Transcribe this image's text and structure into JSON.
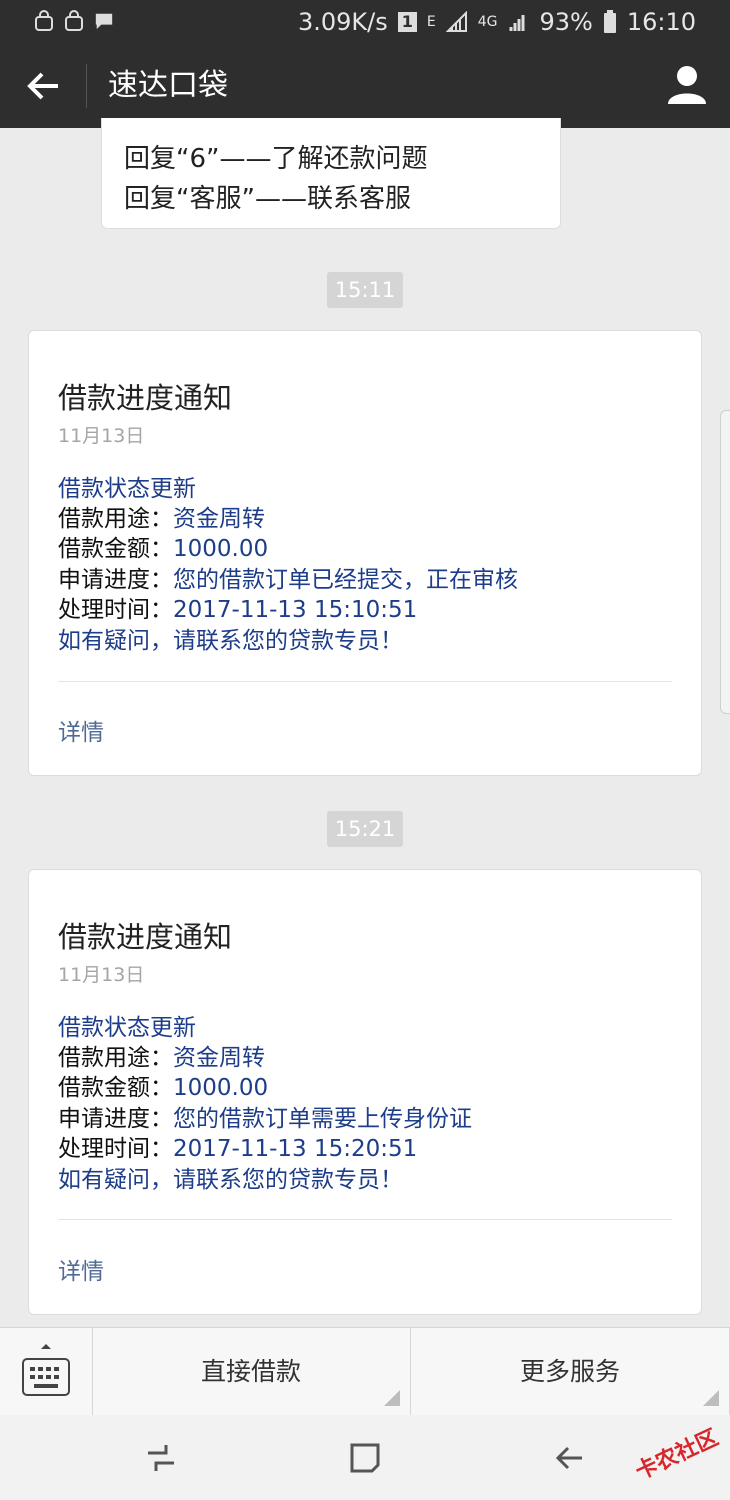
{
  "status_bar": {
    "speed": "3.09K/s",
    "sim": "1",
    "net1": "E",
    "net2": "4G",
    "battery": "93%",
    "time": "16:10"
  },
  "title_bar": {
    "title": "速达口袋"
  },
  "partial_message": {
    "lines": [
      "回复“6”——了解还款问题",
      "回复“客服”——联系客服"
    ]
  },
  "messages": [
    {
      "time": "15:11",
      "card": {
        "title": "借款进度通知",
        "date": "11月13日",
        "heading": "借款状态更新",
        "rows": [
          {
            "label": "借款用途：",
            "value": "资金周转"
          },
          {
            "label": "借款金额：",
            "value": "1000.00"
          },
          {
            "label": "申请进度：",
            "value": "您的借款订单已经提交，正在审核"
          },
          {
            "label": "处理时间：",
            "value": "2017-11-13 15:10:51"
          }
        ],
        "footer": "如有疑问，请联系您的贷款专员！",
        "detail": "详情"
      }
    },
    {
      "time": "15:21",
      "card": {
        "title": "借款进度通知",
        "date": "11月13日",
        "heading": "借款状态更新",
        "rows": [
          {
            "label": "借款用途：",
            "value": "资金周转"
          },
          {
            "label": "借款金额：",
            "value": "1000.00"
          },
          {
            "label": "申请进度：",
            "value": "您的借款订单需要上传身份证"
          },
          {
            "label": "处理时间：",
            "value": "2017-11-13 15:20:51"
          }
        ],
        "footer": "如有疑问，请联系您的贷款专员！",
        "detail": "详情"
      }
    }
  ],
  "menu": {
    "btn1": "直接借款",
    "btn2": "更多服务"
  },
  "watermark": "卡农社区",
  "icons": [
    "bag-icon",
    "bag-icon",
    "message-icon",
    "signal-icon",
    "battery-icon",
    "back-arrow-icon",
    "person-icon",
    "keyboard-icon",
    "recent-apps-icon",
    "home-icon",
    "back-icon"
  ]
}
